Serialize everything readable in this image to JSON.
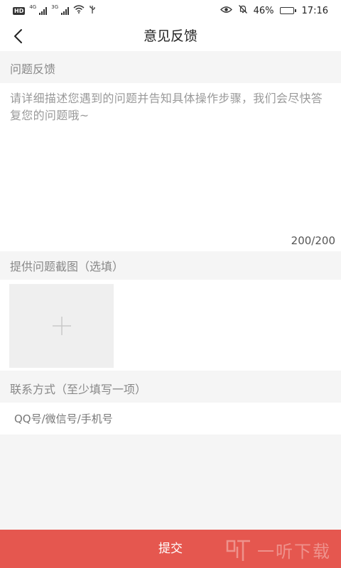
{
  "status_bar": {
    "hd": "HD",
    "net1": "4G",
    "net2": "3G",
    "battery": "46%",
    "battery_level": 0.46,
    "time": "17:16",
    "icons": [
      "hd-icon",
      "signal-icon",
      "signal-icon",
      "wifi-icon",
      "usb-icon",
      "eye-icon",
      "mute-bell-icon",
      "battery-icon"
    ]
  },
  "nav": {
    "back_icon": "chevron-left-icon",
    "title": "意见反馈"
  },
  "feedback": {
    "label": "问题反馈",
    "placeholder": "请详细描述您遇到的问题并告知具体操作步骤，我们会尽快答复您的问题哦~",
    "counter": "200/200"
  },
  "screenshot": {
    "label": "提供问题截图（选填）",
    "add_icon": "plus-icon"
  },
  "contact": {
    "label": "联系方式（至少填写一项）",
    "placeholder": "QQ号/微信号/手机号",
    "value": ""
  },
  "submit_label": "提交",
  "watermark": {
    "text": "一听下载"
  },
  "colors": {
    "accent": "#e5574f",
    "background": "#f5f5f5",
    "tile": "#efefef"
  }
}
